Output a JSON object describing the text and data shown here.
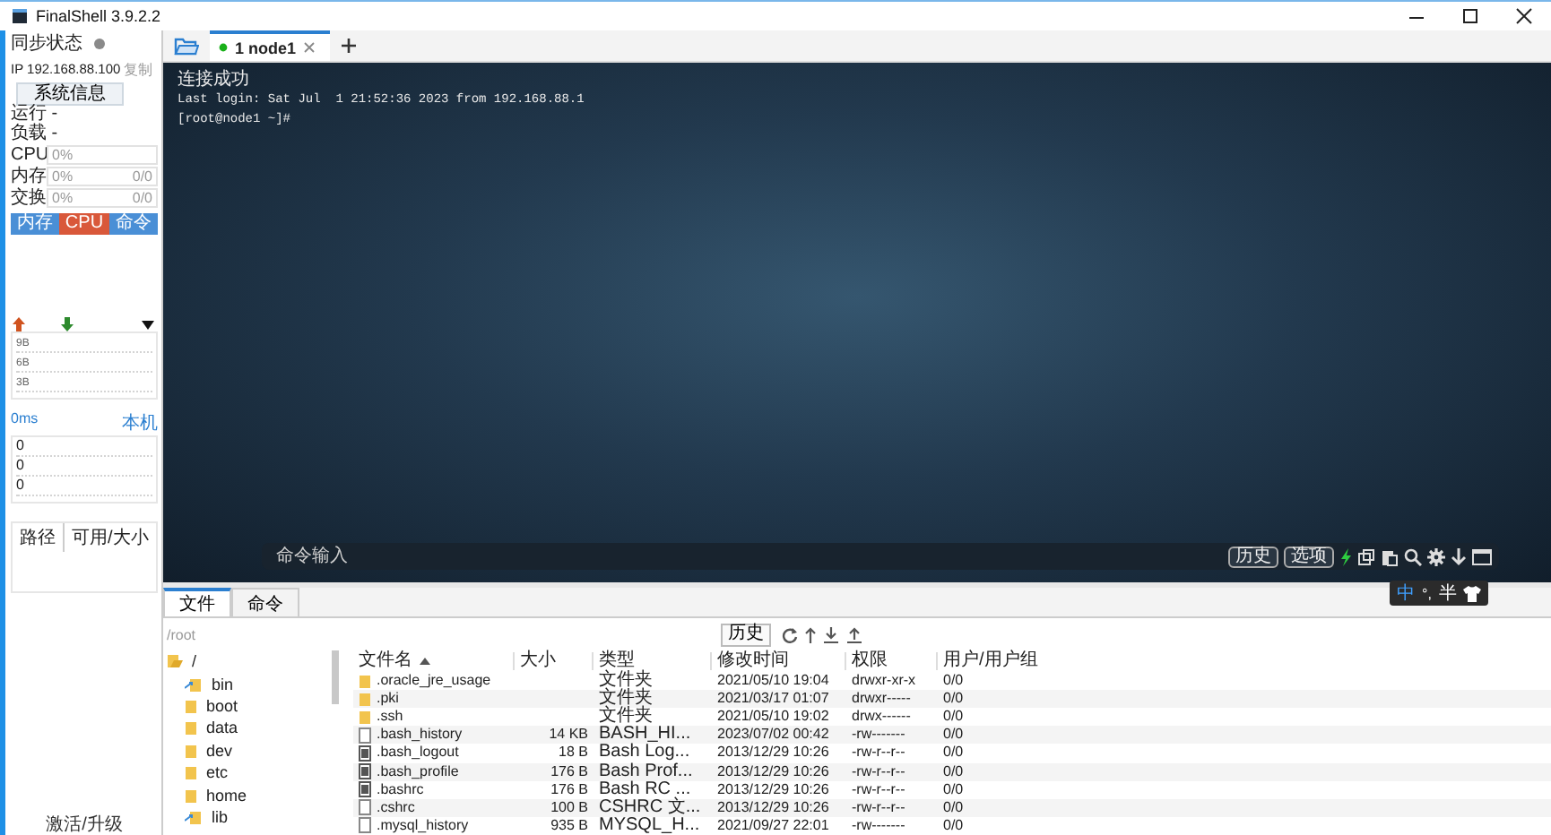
{
  "window": {
    "title": "FinalShell 3.9.2.2"
  },
  "sidebar": {
    "sync_label": "同步状态",
    "ip": "IP 192.168.88.100",
    "copy_link": "复制",
    "sysinfo_button": "系统信息",
    "run": "运行 -",
    "load": "负载 -",
    "meters": [
      {
        "label": "CPU",
        "reading": "0%",
        "level": 0
      },
      {
        "label": "内存",
        "reading": "0%",
        "amount": "0/0",
        "level": 0
      },
      {
        "label": "交换",
        "reading": "0%",
        "amount": "0/0",
        "level": 0
      }
    ],
    "tabs": [
      {
        "label": "内存",
        "selected": false
      },
      {
        "label": "CPU",
        "selected": true
      },
      {
        "label": "命令",
        "selected": false
      }
    ],
    "net_ticks": [
      "9B",
      "6B",
      "3B"
    ],
    "ping": {
      "latency": "0ms",
      "host": "本机",
      "values": [
        "0",
        "0",
        "0"
      ]
    },
    "disk_columns": [
      "路径",
      "可用/大小"
    ],
    "activate_link": "激活/升级"
  },
  "session_tabs": [
    {
      "label": "1 node1",
      "selected": true,
      "connected": true
    }
  ],
  "terminal": {
    "lines": [
      "连接成功",
      "Last login: Sat Jul  1 21:52:36 2023 from 192.168.88.1",
      "[root@node1 ~]#"
    ],
    "command_placeholder": "命令输入",
    "buttons": [
      "历史",
      "选项"
    ]
  },
  "bottom_tabs": [
    {
      "label": "文件",
      "selected": true
    },
    {
      "label": "命令",
      "selected": false
    }
  ],
  "file_browser": {
    "path": "/root",
    "history_button": "历史",
    "tree": [
      {
        "name": "/",
        "kind": "folder",
        "expanded": true,
        "children": [
          {
            "name": "bin",
            "kind": "link"
          },
          {
            "name": "boot",
            "kind": "folder"
          },
          {
            "name": "data",
            "kind": "folder"
          },
          {
            "name": "dev",
            "kind": "folder"
          },
          {
            "name": "etc",
            "kind": "folder"
          },
          {
            "name": "home",
            "kind": "folder"
          },
          {
            "name": "lib",
            "kind": "link"
          }
        ]
      }
    ],
    "columns": [
      {
        "label": "文件名",
        "sorted": true
      },
      {
        "label": "大小"
      },
      {
        "label": "类型"
      },
      {
        "label": "修改时间"
      },
      {
        "label": "权限"
      },
      {
        "label": "用户/用户组"
      }
    ],
    "rows": [
      {
        "kind": "folder",
        "name": ".oracle_jre_usage",
        "type": "文件夹",
        "modified": "2021/05/10 19:04",
        "permissions": "drwxr-xr-x",
        "owner": "0/0"
      },
      {
        "kind": "folder",
        "name": ".pki",
        "type": "文件夹",
        "modified": "2021/03/17 01:07",
        "permissions": "drwxr-----",
        "owner": "0/0"
      },
      {
        "kind": "folder",
        "name": ".ssh",
        "type": "文件夹",
        "modified": "2021/05/10 19:02",
        "permissions": "drwx------",
        "owner": "0/0"
      },
      {
        "kind": "file",
        "name": ".bash_history",
        "size": "14 KB",
        "type": "BASH_HI...",
        "modified": "2023/07/02 00:42",
        "permissions": "-rw-------",
        "owner": "0/0"
      },
      {
        "kind": "script",
        "name": ".bash_logout",
        "size": "18 B",
        "type": "Bash Log...",
        "modified": "2013/12/29 10:26",
        "permissions": "-rw-r--r--",
        "owner": "0/0"
      },
      {
        "kind": "script",
        "name": ".bash_profile",
        "size": "176 B",
        "type": "Bash Prof...",
        "modified": "2013/12/29 10:26",
        "permissions": "-rw-r--r--",
        "owner": "0/0"
      },
      {
        "kind": "script",
        "name": ".bashrc",
        "size": "176 B",
        "type": "Bash RC ...",
        "modified": "2013/12/29 10:26",
        "permissions": "-rw-r--r--",
        "owner": "0/0"
      },
      {
        "kind": "file",
        "name": ".cshrc",
        "size": "100 B",
        "type": "CSHRC 文...",
        "modified": "2013/12/29 10:26",
        "permissions": "-rw-r--r--",
        "owner": "0/0"
      },
      {
        "kind": "file",
        "name": ".mysql_history",
        "size": "935 B",
        "type": "MYSQL_H...",
        "modified": "2021/09/27 22:01",
        "permissions": "-rw-------",
        "owner": "0/0"
      }
    ]
  },
  "ime": {
    "mode": "中",
    "punctuation": "°,",
    "width": "半"
  }
}
